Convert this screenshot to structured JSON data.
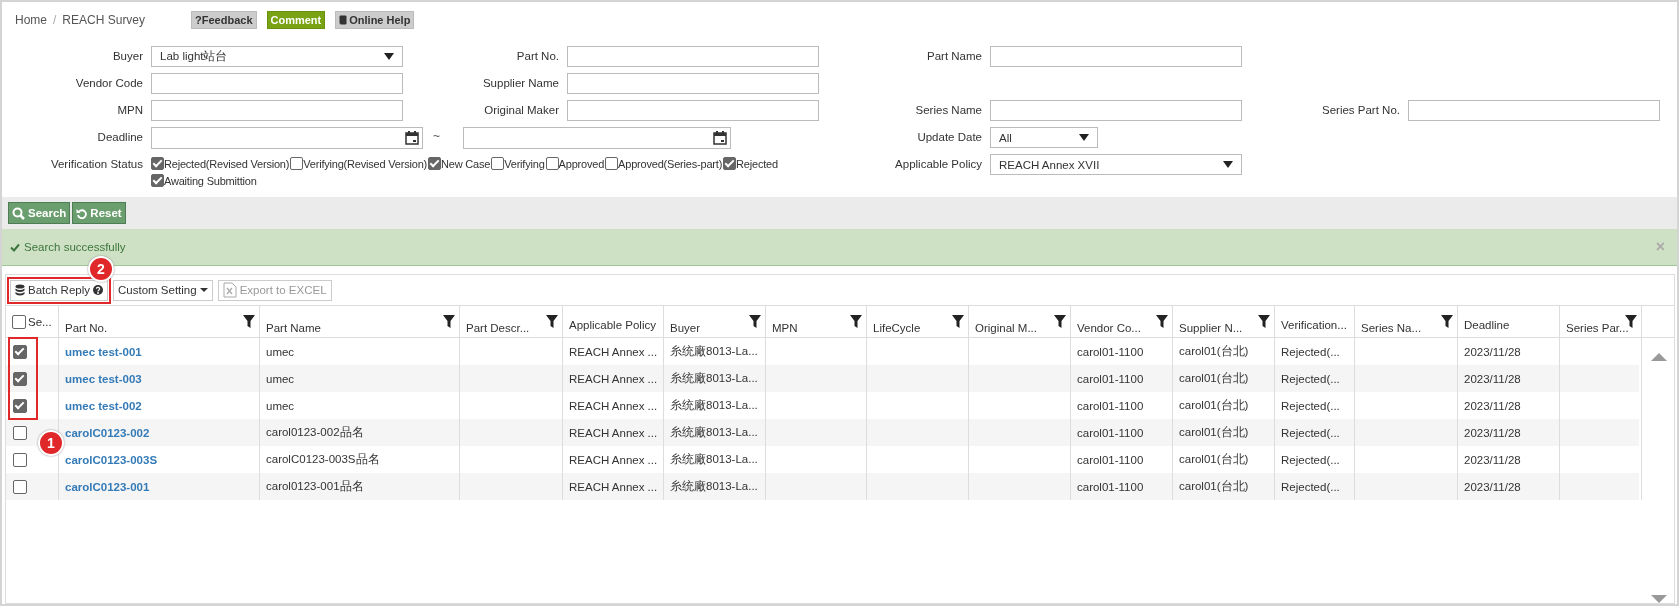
{
  "breadcrumb": {
    "separator": "/",
    "items": [
      {
        "label": "Home"
      },
      {
        "label": "REACH Survey"
      }
    ]
  },
  "header_buttons": [
    {
      "label": "?Feedback",
      "kind": "gray"
    },
    {
      "label": "Comment",
      "kind": "green"
    },
    {
      "label": "Online Help",
      "kind": "help"
    }
  ],
  "form": {
    "rows": [
      [
        {
          "label": "Buyer",
          "kind": "select",
          "value": "Lab light站台"
        },
        {
          "label": "Part No.",
          "kind": "text"
        },
        {
          "label": "Part Name",
          "kind": "text"
        }
      ],
      [
        {
          "label": "Vendor Code",
          "kind": "text"
        },
        {
          "label": "Supplier Name",
          "kind": "text"
        }
      ],
      [
        {
          "label": "MPN",
          "kind": "text"
        },
        {
          "label": "Original Maker",
          "kind": "text"
        },
        {
          "label": "Series Name",
          "kind": "text"
        },
        {
          "label": "Series Part No.",
          "kind": "text"
        }
      ],
      [
        {
          "label": "Deadline",
          "kind": "date_range",
          "separator": "~"
        },
        {
          "label": "Update Date",
          "kind": "select_small",
          "value": "All"
        }
      ],
      [
        {
          "label": "Verification Status",
          "kind": "checks",
          "options": [
            {
              "label": "Rejected(Revised Version)",
              "checked": true
            },
            {
              "label": "Verifying(Revised Version)",
              "checked": false
            },
            {
              "label": "New Case",
              "checked": true
            },
            {
              "label": "Verifying",
              "checked": false
            },
            {
              "label": "Approved",
              "checked": false
            },
            {
              "label": "Approved(Series-part)",
              "checked": false
            },
            {
              "label": "Rejected",
              "checked": true
            },
            {
              "label": "Awaiting Submittion",
              "checked": true
            }
          ]
        },
        {
          "label": "Applicable Policy",
          "kind": "select",
          "value": "REACH Annex XVII"
        }
      ]
    ]
  },
  "actions": [
    {
      "label": "Search",
      "kind": "search"
    },
    {
      "label": "Reset",
      "kind": "reset"
    }
  ],
  "alert": {
    "text": "Search successfully",
    "close": "×"
  },
  "grid_toolbar": [
    {
      "label": "Batch Reply",
      "kind": "batch",
      "disabled": false
    },
    {
      "label": "Custom Setting",
      "kind": "dropdown",
      "disabled": false
    },
    {
      "label": "Export to EXCEL",
      "kind": "excel",
      "disabled": true
    }
  ],
  "table": {
    "select_all": {
      "label": "Se...",
      "checked": false
    },
    "columns": [
      {
        "label": "Part No.",
        "filter": true
      },
      {
        "label": "Part Name",
        "filter": true
      },
      {
        "label": "Part Descr...",
        "filter": true
      },
      {
        "label": "Applicable Policy",
        "filter": false
      },
      {
        "label": "Buyer",
        "filter": true
      },
      {
        "label": "MPN",
        "filter": true
      },
      {
        "label": "LifeCycle",
        "filter": true
      },
      {
        "label": "Original M...",
        "filter": true
      },
      {
        "label": "Vendor Co...",
        "filter": true
      },
      {
        "label": "Supplier N...",
        "filter": true
      },
      {
        "label": "Verification...",
        "filter": false
      },
      {
        "label": "Series Na...",
        "filter": true
      },
      {
        "label": "Deadline",
        "filter": false
      },
      {
        "label": "Series Par...",
        "filter": true
      }
    ],
    "rows": [
      {
        "checked": true,
        "cells": [
          "umec test-001",
          "umec",
          "",
          "REACH Annex ...",
          "糸统廠8013-La...",
          "",
          "",
          "",
          "carol01-1100",
          "carol01(台北)",
          "Rejected(...",
          "",
          "2023/11/28",
          ""
        ]
      },
      {
        "checked": true,
        "cells": [
          "umec test-003",
          "umec",
          "",
          "REACH Annex ...",
          "糸统廠8013-La...",
          "",
          "",
          "",
          "carol01-1100",
          "carol01(台北)",
          "Rejected(...",
          "",
          "2023/11/28",
          ""
        ]
      },
      {
        "checked": true,
        "cells": [
          "umec test-002",
          "umec",
          "",
          "REACH Annex ...",
          "糸统廠8013-La...",
          "",
          "",
          "",
          "carol01-1100",
          "carol01(台北)",
          "Rejected(...",
          "",
          "2023/11/28",
          ""
        ]
      },
      {
        "checked": false,
        "cells": [
          "carolC0123-002",
          "carol0123-002品名",
          "",
          "REACH Annex ...",
          "糸统廠8013-La...",
          "",
          "",
          "",
          "carol01-1100",
          "carol01(台北)",
          "Rejected(...",
          "",
          "2023/11/28",
          ""
        ]
      },
      {
        "checked": false,
        "cells": [
          "carolC0123-003S",
          "carolC0123-003S品名",
          "",
          "REACH Annex ...",
          "糸统廠8013-La...",
          "",
          "",
          "",
          "carol01-1100",
          "carol01(台北)",
          "Rejected(...",
          "",
          "2023/11/28",
          ""
        ]
      },
      {
        "checked": false,
        "cells": [
          "carolC0123-001",
          "carol0123-001品名",
          "",
          "REACH Annex ...",
          "糸统廠8013-La...",
          "",
          "",
          "",
          "carol01-1100",
          "carol01(台北)",
          "Rejected(...",
          "",
          "2023/11/28",
          ""
        ]
      }
    ]
  },
  "annotations": [
    {
      "label": "1",
      "kind": "rows"
    },
    {
      "label": "2",
      "kind": "batch"
    }
  ]
}
